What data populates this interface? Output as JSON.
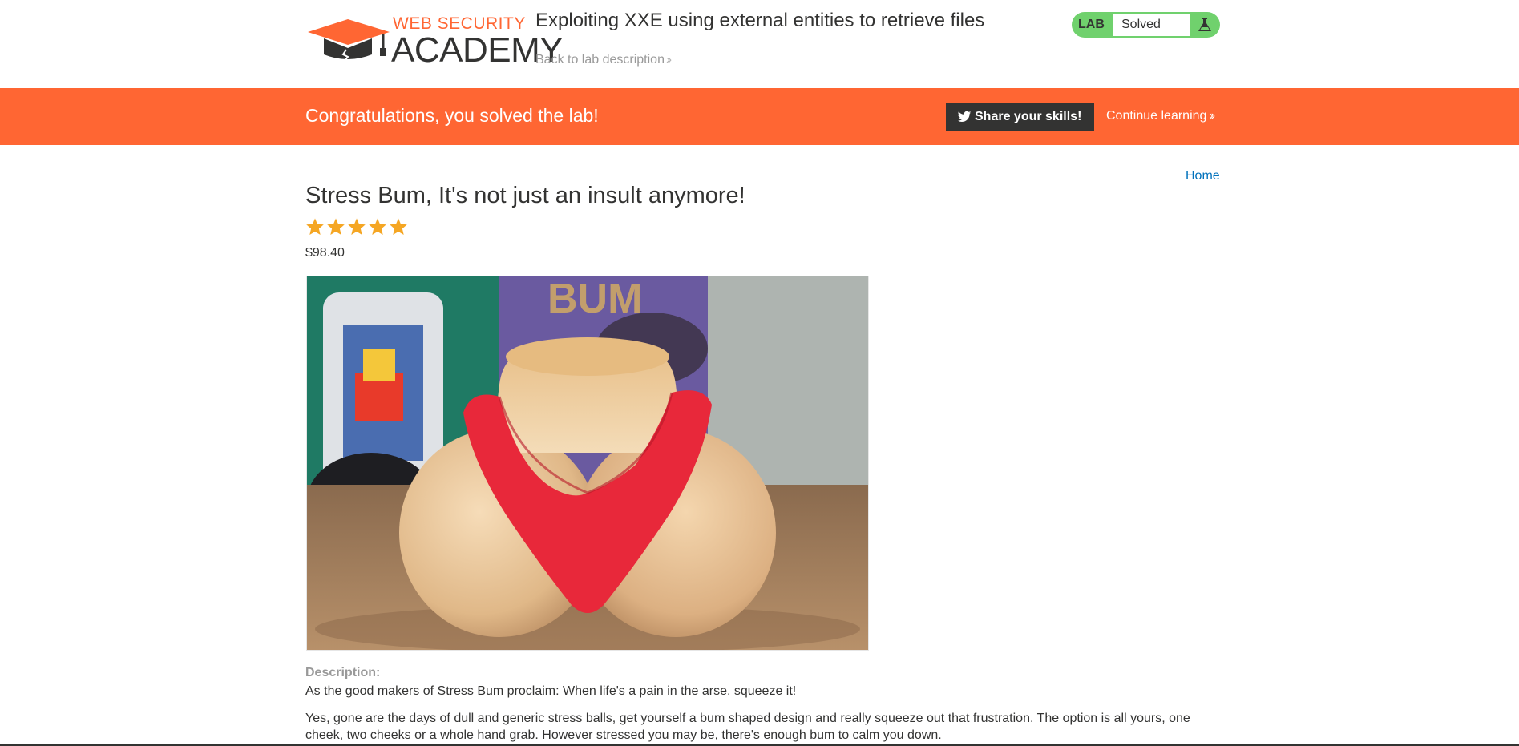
{
  "header": {
    "logo_top": "WEB SECURITY",
    "logo_bottom": "ACADEMY",
    "lab_title": "Exploiting XXE using external entities to retrieve files",
    "back_link": "Back to lab description",
    "lab_badge": "LAB",
    "lab_status": "Solved",
    "icons": {
      "logo": "graduation-cap-logo-icon",
      "status": "flask-icon",
      "back": "double-chevron-right-icon"
    }
  },
  "banner": {
    "message": "Congratulations, you solved the lab!",
    "share_label": "Share your skills!",
    "continue_label": "Continue learning",
    "icons": {
      "share": "twitter-icon",
      "continue": "double-chevron-right-icon"
    },
    "color": "#ff6633"
  },
  "nav": {
    "home_label": "Home"
  },
  "product": {
    "title": "Stress Bum, It's not just an insult anymore!",
    "rating": 5,
    "rating_max": 5,
    "price": "$98.40",
    "image_icon": "product-photo",
    "description_label": "Description:",
    "description_p1": "As the good makers of Stress Bum proclaim: When life's a pain in the arse, squeeze it!",
    "description_p2": "Yes, gone are the days of dull and generic stress balls, get yourself a bum shaped design and really squeeze out that frustration. The option is all yours, one cheek, two cheeks or a whole hand grab. However stressed you may be, there's enough bum to calm you down."
  },
  "colors": {
    "accent": "#ff6633",
    "solved": "#70d16d",
    "link": "#0071bc",
    "star": "#f5a623",
    "dark": "#333332"
  }
}
